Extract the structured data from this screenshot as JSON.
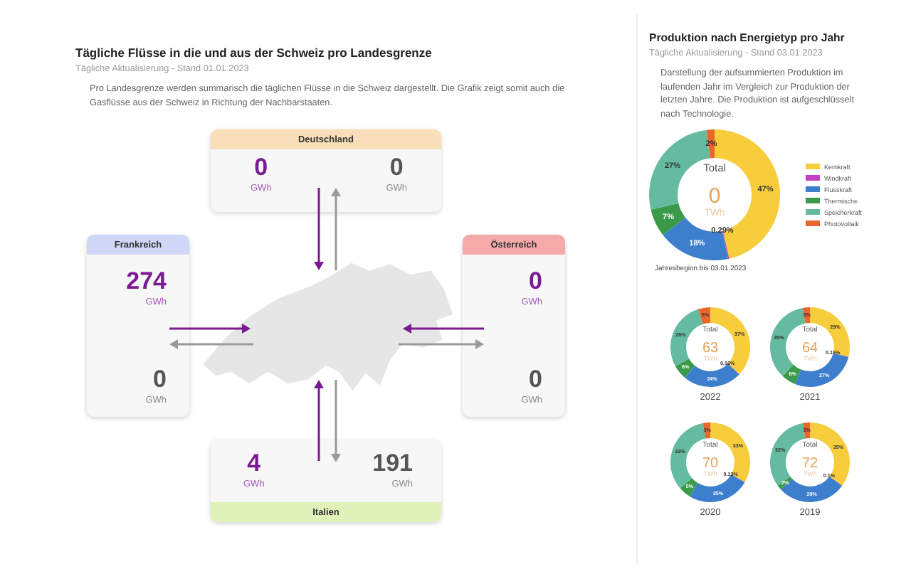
{
  "flows": {
    "title": "Tägliche Flüsse in die und aus der Schweiz pro Landesgrenze",
    "subtitle": "Tägliche Aktualisierung - Stand 01.01.2023",
    "description": "Pro Landesgrenze werden summarisch die täglichen Flüsse in die Schweiz dargestellt. Die Grafik zeigt somit auch die Gasflüsse aus der Schweiz in Richtung der Nachbarstaaten.",
    "borders": [
      {
        "kind": "top",
        "country": "Deutschland",
        "color": "#f8deb9",
        "import": {
          "value": "0",
          "unit": "GWh"
        },
        "export": {
          "value": "0",
          "unit": "GWh"
        }
      },
      {
        "kind": "left",
        "country": "Frankreich",
        "color": "#cfd6f8",
        "import": {
          "value": "274",
          "unit": "GWh"
        },
        "export": {
          "value": "0",
          "unit": "GWh"
        }
      },
      {
        "kind": "right",
        "country": "Österreich",
        "color": "#f5aaaa",
        "import": {
          "value": "0",
          "unit": "GWh"
        },
        "export": {
          "value": "0",
          "unit": "GWh"
        }
      },
      {
        "kind": "bottom",
        "country": "Italien",
        "color": "#e0f2b8",
        "import": {
          "value": "4",
          "unit": "GWh"
        },
        "export": {
          "value": "191",
          "unit": "GWh"
        }
      }
    ]
  },
  "production": {
    "title": "Produktion nach Energietyp pro Jahr",
    "subtitle": "Tägliche Aktualisierung - Stand 03.01.2023",
    "description": "Darstellung der aufsummierten Produktion im laufenden Jahr im Vergleich zur Produktion der letzten Jahre. Die Produktion ist aufgeschlüsselt nach Technologie.",
    "legend": [
      {
        "color": "#f7cd3c"
      },
      {
        "color": "#c43fc4"
      },
      {
        "color": "#3d7fcc"
      },
      {
        "color": "#3a9a4a"
      },
      {
        "color": "#65bb9f"
      },
      {
        "color": "#e8672d"
      }
    ],
    "current": {
      "total": {
        "label": "Total",
        "value": "0",
        "unit": "TWh"
      },
      "chart_data": {
        "type": "donut",
        "xlabel": "Jahresbeginn bis 03.01.2023",
        "categories": [
          "Kernkraft",
          "Windkraft",
          "Flusskraft",
          "Thermische",
          "Speicherkraft",
          "Photovoltaik"
        ],
        "values": [
          47,
          0.29,
          18,
          7,
          27,
          2
        ],
        "value_labels": [
          "47%",
          "0.29%",
          "18%",
          "7%",
          "27%",
          "2%"
        ]
      }
    },
    "years": [
      {
        "total": {
          "label": "Total",
          "value": "63",
          "unit": "TWh"
        },
        "chart_data": {
          "type": "donut",
          "xlabel": "2022",
          "values": [
            37,
            0.16,
            24,
            6,
            28,
            5
          ],
          "value_labels": [
            "37%",
            "0.16%",
            "24%",
            "6%",
            "28%",
            "5%"
          ]
        }
      },
      {
        "total": {
          "label": "Total",
          "value": "64",
          "unit": "TWh"
        },
        "chart_data": {
          "type": "donut",
          "xlabel": "2021",
          "values": [
            29,
            0.15,
            27,
            6,
            35,
            3
          ],
          "value_labels": [
            "29%",
            "0.15%",
            "27%",
            "6%",
            "35%",
            "3%"
          ]
        }
      },
      {
        "total": {
          "label": "Total",
          "value": "70",
          "unit": "TWh"
        },
        "chart_data": {
          "type": "donut",
          "xlabel": "2020",
          "values": [
            33,
            0.13,
            25,
            5,
            33,
            3
          ],
          "value_labels": [
            "33%",
            "0.13%",
            "25%",
            "5%",
            "33%",
            "3%"
          ]
        }
      },
      {
        "total": {
          "label": "Total",
          "value": "72",
          "unit": "TWh"
        },
        "chart_data": {
          "type": "donut",
          "xlabel": "2019",
          "values": [
            35,
            0.1,
            28,
            2,
            32,
            3
          ],
          "value_labels": [
            "35%",
            "0.1%",
            "28%",
            "2%",
            "32%",
            "3%"
          ]
        }
      }
    ]
  }
}
